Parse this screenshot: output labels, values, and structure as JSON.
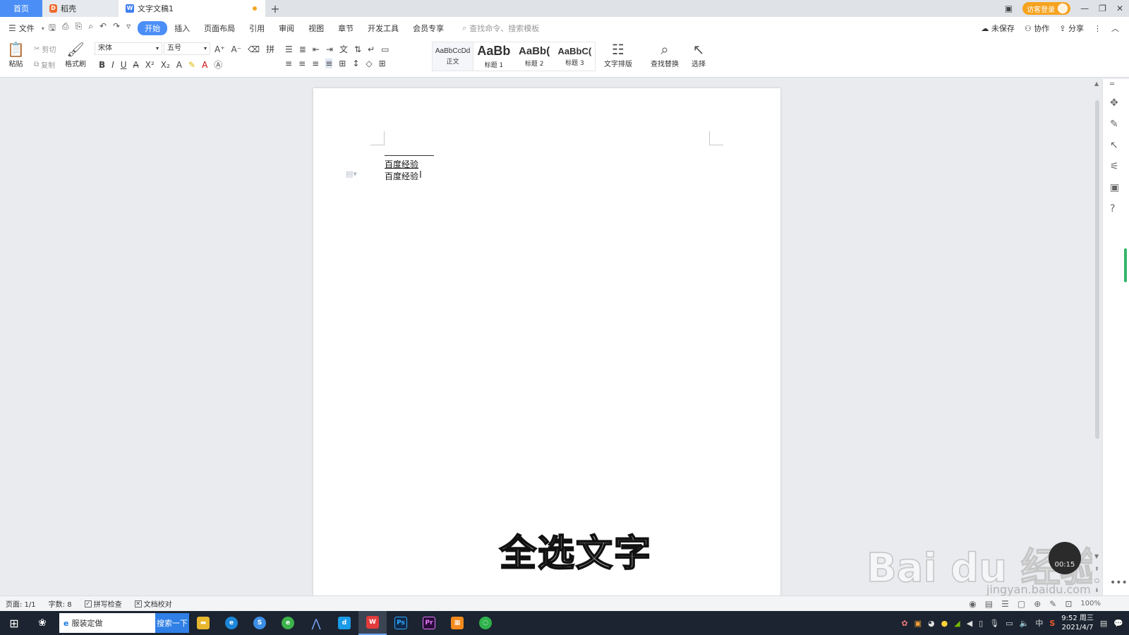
{
  "tabs": {
    "home": "首页",
    "daoke": "稻壳",
    "doc": "文字文稿1",
    "add": "+"
  },
  "titlebar": {
    "login": "访客登录"
  },
  "menu": {
    "file": "文件",
    "items": [
      "开始",
      "插入",
      "页面布局",
      "引用",
      "审阅",
      "视图",
      "章节",
      "开发工具",
      "会员专享"
    ],
    "search_placeholder": "查找命令、搜索模板",
    "unsaved": "未保存",
    "collab": "协作",
    "share": "分享"
  },
  "ribbon": {
    "paste": "粘贴",
    "cut": "剪切",
    "copy": "复制",
    "format_painter": "格式刷",
    "font_name": "宋体",
    "font_size": "五号",
    "styles": [
      {
        "preview": "AaBbCcDd",
        "label": "正文"
      },
      {
        "preview": "AaBb",
        "label": "标题 1"
      },
      {
        "preview": "AaBb(",
        "label": "标题 2"
      },
      {
        "preview": "AaBbC(",
        "label": "标题 3"
      }
    ],
    "text_layout": "文字排版",
    "find_replace": "查找替换",
    "select": "选择"
  },
  "document": {
    "lines": [
      "百度经验",
      "百度经验"
    ]
  },
  "overlay": {
    "caption": "全选文字",
    "watermark": "Bai du 经验",
    "watermark_url": "jingyan.baidu.com",
    "timer": "00:15"
  },
  "status": {
    "page": "页面: 1/1",
    "words": "字数: 8",
    "spell": "拼写检查",
    "proof": "文档校对",
    "zoom": "100%"
  },
  "taskbar": {
    "search_text": "服装定做",
    "search_btn": "搜索一下",
    "time": "9:52 周三",
    "date": "2021/4/7",
    "ime": "中"
  }
}
